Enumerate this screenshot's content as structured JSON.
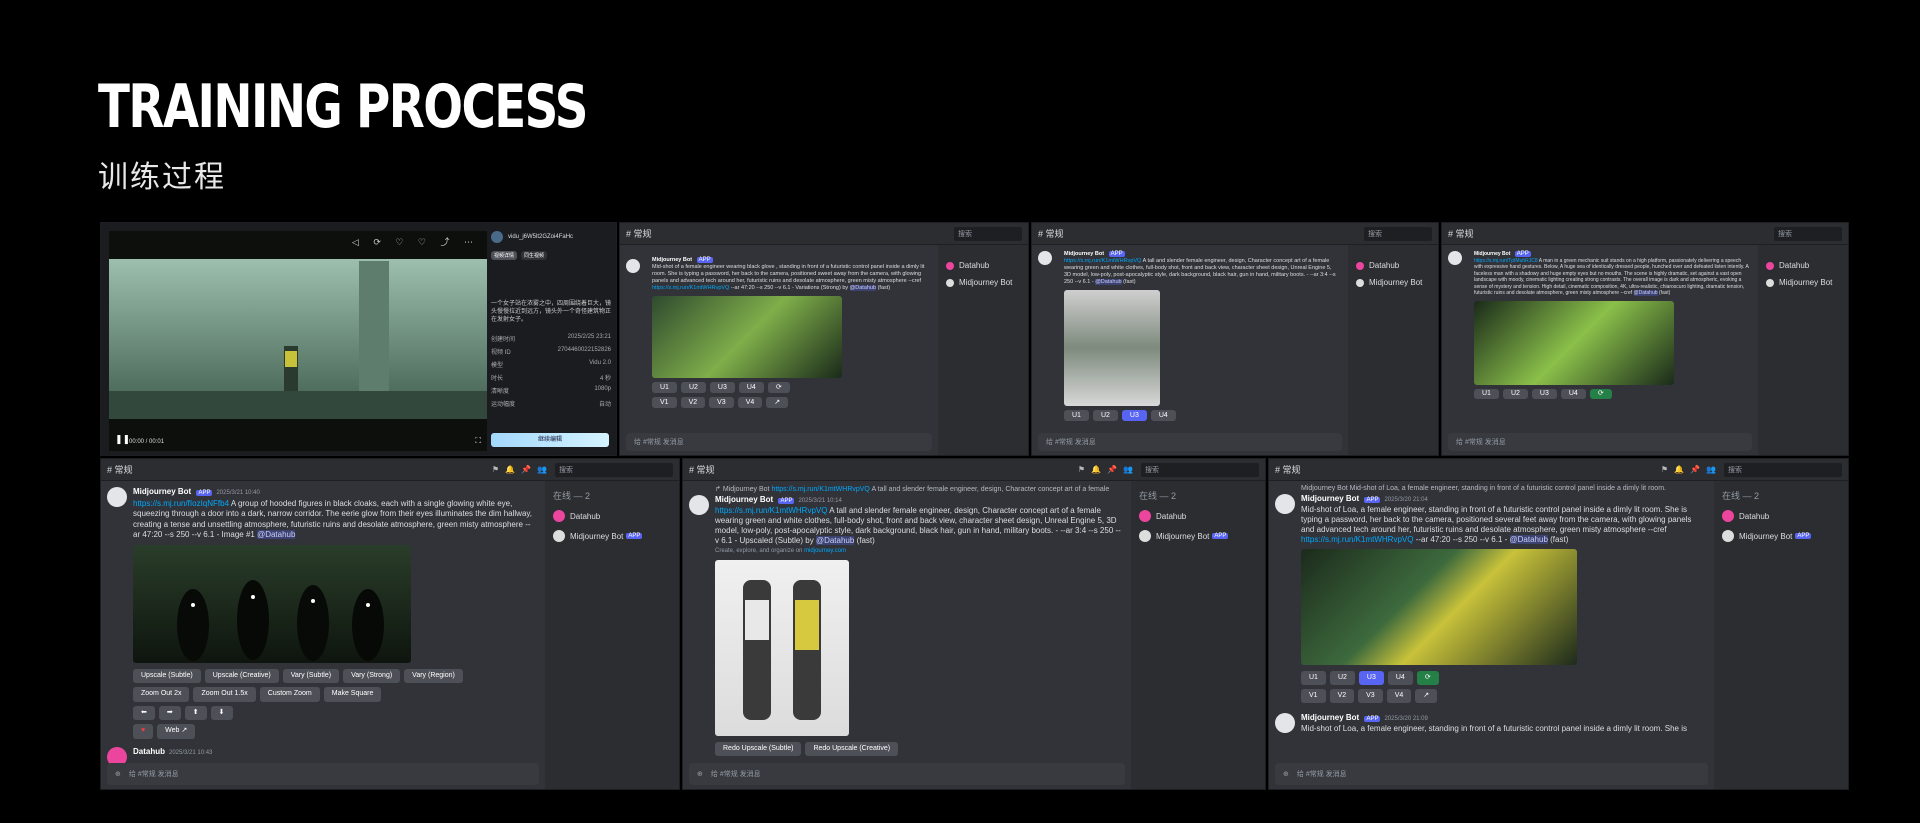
{
  "title": "TRAINING PROCESS",
  "subtitle": "训练过程",
  "channel": "常规",
  "search_placeholder": "搜索",
  "online": "在线 — 2",
  "members": [
    "Datahub",
    "Midjourney Bot"
  ],
  "app_badge": "APP",
  "input_placeholder": "给 #常规 发消息",
  "video": {
    "id": "vidu_j6W5lt2GZoi4FaHc",
    "tabs": [
      "视频详情",
      "同生视频"
    ],
    "prompt": "一个女子站在浓雾之中，四周围绕着巨大，镜头慢慢拉近到远方，镜头外一个奇怪建筑物正在发射女子。",
    "fields": [
      {
        "k": "创建时间",
        "v": "2025/2/25 23:21"
      },
      {
        "k": "视频 ID",
        "v": "2704460022152826"
      },
      {
        "k": "模型",
        "v": "Vidu 2.0"
      },
      {
        "k": "时长",
        "v": "4 秒"
      },
      {
        "k": "清晰度",
        "v": "1080p"
      },
      {
        "k": "运动幅度",
        "v": "自动"
      }
    ],
    "time": "00:00 / 00:01",
    "action": "继续编辑"
  },
  "panels": {
    "p2": {
      "author": "Midjourney Bot",
      "text": "Mid-shot of a female engineer wearing black glove , standing in front of a futuristic control panel inside a dimly lit room. She is typing a password, her back to the camera, positioned sweet away from the camera, with glowing panels and advanced tech around her, futuristic ruins and desolate atmosphere, green misty atmosphere --cref",
      "link": "https://s.mj.run/K1mtWHRvpVQ",
      "tail": "--ar 47:20 --s 250 --v 6.1 - Variations (Strong) by",
      "mention": "@Datahub",
      "speed": "(fast)"
    },
    "p3": {
      "author": "Midjourney Bot",
      "link": "https://s.mj.run/K1mtWHRvpVQ",
      "text": "A tall and slender female engineer, design, Character concept art of a female wearing green and white clothes, full-body shot, front and back view, character sheet design, Unreal Engine 5, 3D model, low-poly, post-apocalyptic style, dark background, black hair, gun in hand, military boots. - --ar 3:4 --s 250 --v 6.1 -",
      "mention": "@Datahub",
      "speed": "(fast)"
    },
    "p4": {
      "author": "Midjourney Bot",
      "link": "https://s.mj.run/TpIMuhRJC8",
      "text": "A man in a green mechanic suit stands on a high platform, passionately delivering a speech with expressive hand gestures. Below, A huge sea of identically dressed people, hunched over and defeated listen intently. A faceless man with a shadowy and huge empty eyes but no mouths. The scene is highly dramatic, set against a vast open landscape with moody, cinematic lighting creating strong contrasts. The overall image is dark and atmospheric, evoking a sense of mystery and tension. High detail, cinematic composition, 4K, ultra-realistic, chiaroscuro lighting, dramatic tension, futuristic ruins and desolate atmosphere, green misty atmosphere --cref",
      "mention": "@Datahub",
      "speed": "(fast)"
    },
    "p5": {
      "author": "Midjourney Bot",
      "time": "2025/3/21 10:40",
      "link": "https://s.mj.run/fIozIqNFfb4",
      "text": "A group of hooded figures in black cloaks, each with a single glowing white eye, squeezing through a door into a dark, narrow corridor. The eerie glow from their eyes illuminates the dim hallway, creating a tense and unsettling atmosphere, futuristic ruins and desolate atmosphere, green misty atmosphere --ar 47:20 --s 250 --v 6.1 - Image #1",
      "mention": "@Datahub",
      "buttons": [
        "Upscale (Subtle)",
        "Upscale (Creative)",
        "Vary (Subtle)",
        "Vary (Strong)",
        "Vary (Region)",
        "Zoom Out 2x",
        "Zoom Out 1.5x",
        "Custom Zoom",
        "Make Square"
      ],
      "web": "Web",
      "next_author": "Datahub",
      "next_time": "2025/3/21 10:43"
    },
    "p6": {
      "ref_author": "Midjourney Bot",
      "ref_link": "https://s.mj.run/K1mtWHRvpVQ",
      "ref_text": "A tall and slender female engineer, design, Character concept art of a female",
      "author": "Midjourney Bot",
      "time": "2025/3/21 10:14",
      "link": "https://s.mj.run/K1mtWHRvpVQ",
      "text": "A tall and slender female engineer, design, Character concept art of a female wearing green and white clothes, full-body shot, front and back view, character sheet design, Unreal Engine 5, 3D model, low-poly, post-apocalyptic style, dark background, black hair, gun in hand, military boots. - --ar 3:4 --s 250 --v 6.1 - Upscaled (Subtle) by",
      "mention": "@Datahub",
      "speed": "(fast)",
      "footnote": "Create, explore, and organize on",
      "footlink": "midjourney.com",
      "buttons": [
        "Redo Upscale (Subtle)",
        "Redo Upscale (Creative)"
      ]
    },
    "p7": {
      "ref_text": "Midjourney Bot  Mid-shot of Loa, a female engineer, standing in front of a futuristic control panel inside a dimly lit room.",
      "author": "Midjourney Bot",
      "time": "2025/3/20 21:04",
      "text": "Mid-shot of Loa, a female engineer, standing in front of a futuristic control panel inside a dimly lit room. She is typing a password, her back to the camera, positioned several feet away from the camera, with glowing panels and advanced tech around her, futuristic ruins and desolate atmosphere, green misty atmosphere --cref",
      "link": "https://s.mj.run/K1mtWHRvpVQ",
      "tail": "--ar 47:20 --s 250 --v 6.1 -",
      "mention": "@Datahub",
      "speed": "(fast)",
      "u": [
        "U1",
        "U2",
        "U3",
        "U4"
      ],
      "v": [
        "V1",
        "V2",
        "V3",
        "V4"
      ],
      "next_time": "2025/3/20 21:09",
      "next_text": "Mid-shot of Loa, a female engineer, standing in front of a futuristic control panel inside a dimly lit room. She is"
    }
  },
  "colors": {
    "bg": "#000000",
    "discord": "#313338",
    "sidebar": "#2b2d31",
    "accent": "#5865f2",
    "link": "#00a8fc",
    "green": "#248046"
  }
}
